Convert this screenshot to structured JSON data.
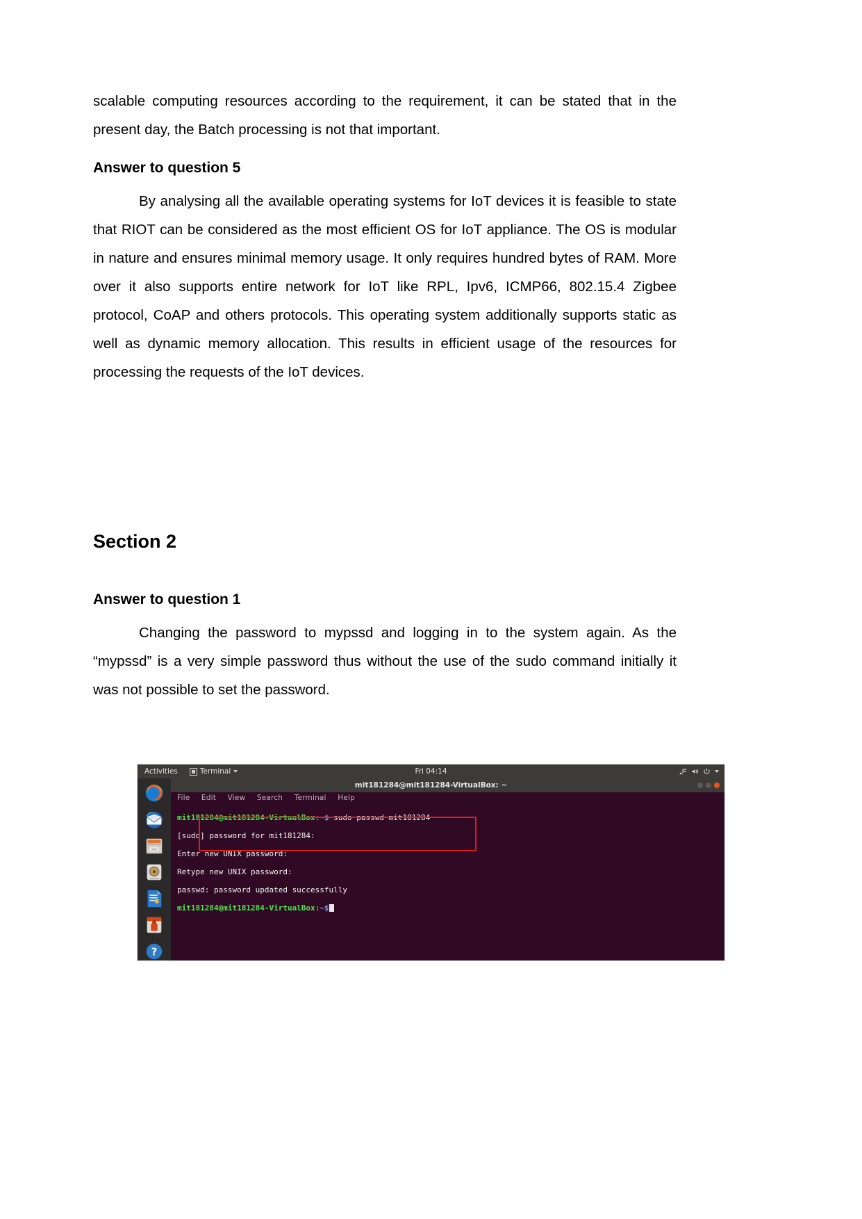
{
  "document": {
    "page_background": "#ffffff",
    "top_paragraph": "scalable computing resources according to the requirement, it can be stated that in the present day, the Batch processing is not that important.",
    "heading_q5": "Answer to question 5",
    "paragraph_q5": "By analysing all the available operating systems for IoT devices it is feasible to state that RIOT can be considered as the most efficient OS for IoT appliance.   The OS is modular in nature and ensures minimal memory usage. It only requires hundred bytes of RAM. More over it also  supports entire network for IoT  like RPL, Ipv6, ICMP66, 802.15.4 Zigbee protocol,  CoAP and others protocols.   This operating system additionally supports static as well as dynamic memory allocation. This results in efficient usage of the resources for processing the requests of the IoT devices.",
    "heading_section2": "Section 2",
    "heading_q1": "Answer to question 1",
    "paragraph_q1": "Changing the password to mypssd and logging in to the system again. As the “mypssd” is a very simple password thus without the use of the sudo command initially it was not possible to set the password."
  },
  "screenshot": {
    "topbar": {
      "activities": "Activities",
      "app_menu": "Terminal",
      "clock": "Fri 04:14",
      "icons": [
        "network-icon",
        "volume-icon",
        "power-icon",
        "chevron-down-icon"
      ]
    },
    "window": {
      "title": "mit181284@mit181284-VirtualBox: ~",
      "buttons": [
        "minimize",
        "maximize",
        "close"
      ],
      "close_color": "#e95420"
    },
    "menubar": [
      "File",
      "Edit",
      "View",
      "Search",
      "Terminal",
      "Help"
    ],
    "dock_items": [
      "firefox-icon",
      "thunderbird-icon",
      "files-icon",
      "rhythmbox-icon",
      "libreoffice-writer-icon",
      "ubuntu-software-icon",
      "help-icon",
      "amazon-icon",
      "show-applications-icon"
    ],
    "terminal": {
      "background": "#300a24",
      "prompt_user": "mit181284@mit181284-VirtualBox",
      "prompt_path": ":~$",
      "lines": [
        {
          "type": "prompt",
          "user": "mit181284@mit181284-VirtualBox",
          "path": ":~$",
          "command": " sudo passwd mit181284"
        },
        {
          "type": "output",
          "text": "[sudo] password for mit181284:"
        },
        {
          "type": "output",
          "text": "Enter new UNIX password:"
        },
        {
          "type": "output",
          "text": "Retype new UNIX password:"
        },
        {
          "type": "output",
          "text": "passwd: password updated successfully"
        },
        {
          "type": "prompt",
          "user": "mit181284@mit181284-VirtualBox",
          "path": ":~$",
          "command": " "
        }
      ]
    },
    "annotation": {
      "type": "rectangle",
      "color": "#d81f1f"
    }
  }
}
